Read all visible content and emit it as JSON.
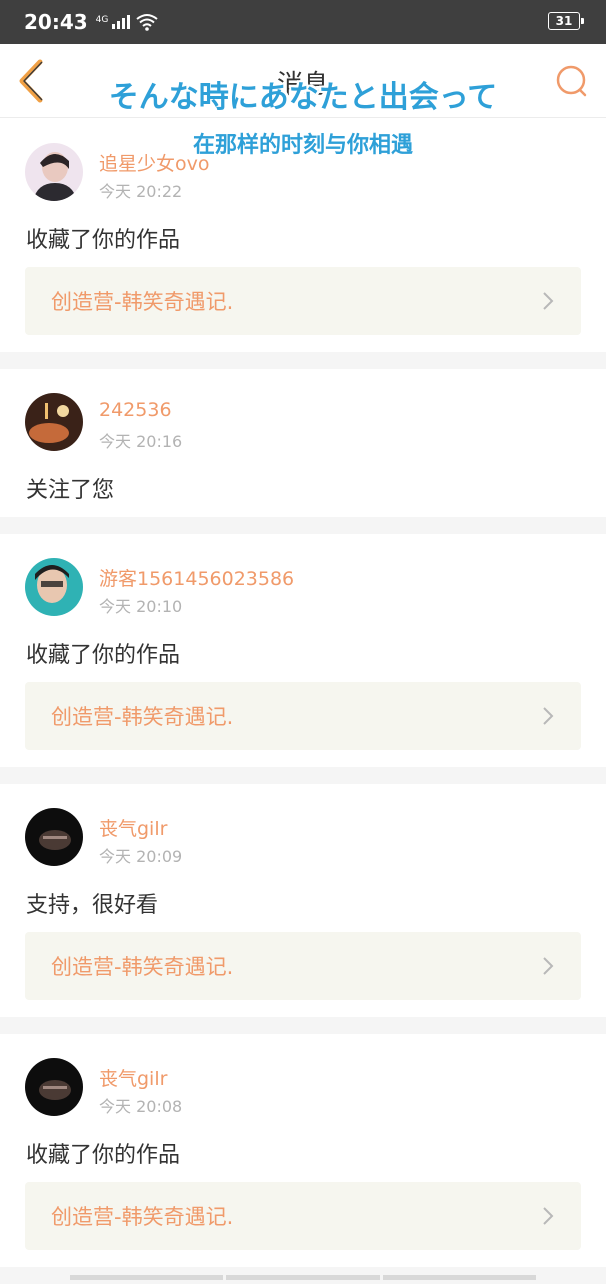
{
  "status_bar": {
    "time": "20:43",
    "network": "4G",
    "battery": "31"
  },
  "nav": {
    "title": "消息",
    "back_icon": "chevron-left-icon",
    "search_icon": "search-icon"
  },
  "overlay": {
    "japanese": "そんな時にあなたと出会って",
    "chinese": "在那样的时刻与你相遇"
  },
  "messages": [
    {
      "user": "追星少女ovo",
      "time": "今天 20:22",
      "content": "收藏了你的作品",
      "work": "创造营-韩笑奇遇记."
    },
    {
      "user": "242536",
      "time": "今天 20:16",
      "content": "关注了您"
    },
    {
      "user": "游客1561456023586",
      "time": "今天 20:10",
      "content": "收藏了你的作品",
      "work": "创造营-韩笑奇遇记."
    },
    {
      "user": "丧气gilr",
      "time": "今天 20:09",
      "content": "支持，很好看",
      "work": "创造营-韩笑奇遇记."
    },
    {
      "user": "丧气gilr",
      "time": "今天 20:08",
      "content": "收藏了你的作品",
      "work": "创造营-韩笑奇遇记."
    }
  ],
  "colors": {
    "accent": "#f09a6a",
    "status_bar": "#3f3f3f",
    "card_bg": "#f6f6ef",
    "overlay_text": "#2ea0d8"
  }
}
